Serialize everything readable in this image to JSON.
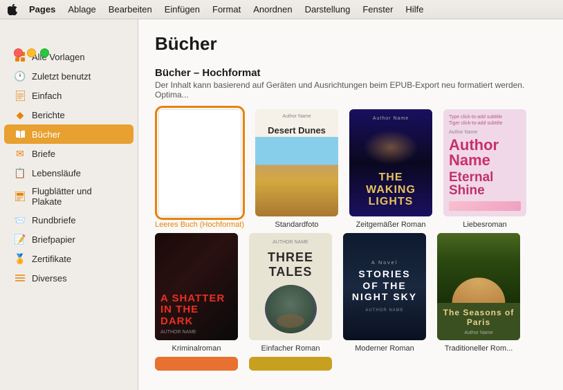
{
  "menubar": {
    "apple": "🍎",
    "items": [
      {
        "label": "Pages",
        "bold": true
      },
      {
        "label": "Ablage"
      },
      {
        "label": "Bearbeiten"
      },
      {
        "label": "Einfügen"
      },
      {
        "label": "Format"
      },
      {
        "label": "Anordnen"
      },
      {
        "label": "Darstellung"
      },
      {
        "label": "Fenster"
      },
      {
        "label": "Hilfe"
      }
    ]
  },
  "sidebar": {
    "items": [
      {
        "id": "alle-vorlagen",
        "label": "Alle Vorlagen",
        "icon": "⊞"
      },
      {
        "id": "zuletzt",
        "label": "Zuletzt benutzt",
        "icon": "🕐"
      },
      {
        "id": "einfach",
        "label": "Einfach",
        "icon": "📄"
      },
      {
        "id": "berichte",
        "label": "Berichte",
        "icon": "◆"
      },
      {
        "id": "buecher",
        "label": "Bücher",
        "icon": "📖",
        "active": true
      },
      {
        "id": "briefe",
        "label": "Briefe",
        "icon": "✉"
      },
      {
        "id": "lebenslaufe",
        "label": "Lebensläufe",
        "icon": "📋"
      },
      {
        "id": "flugblatter",
        "label": "Flugblätter und Plakate",
        "icon": "📰"
      },
      {
        "id": "rundbriefe",
        "label": "Rundbriefe",
        "icon": "📨"
      },
      {
        "id": "briefpapier",
        "label": "Briefpapier",
        "icon": "📝"
      },
      {
        "id": "zertifikate",
        "label": "Zertifikate",
        "icon": "🏅"
      },
      {
        "id": "diverses",
        "label": "Diverses",
        "icon": "☰"
      }
    ]
  },
  "content": {
    "title": "Bücher",
    "section1": {
      "title": "Bücher – Hochformat",
      "desc": "Der Inhalt kann basierend auf Geräten und Ausrichtungen beim EPUB-Export neu formatiert werden. Optima..."
    },
    "templates_row1": [
      {
        "id": "leeres-buch",
        "label": "Leeres Buch (Hochformat)",
        "selected": true,
        "type": "empty"
      },
      {
        "id": "standardfoto",
        "label": "Standardfoto",
        "type": "desert"
      },
      {
        "id": "zeitgemaesser",
        "label": "Zeitgemäßer Roman",
        "type": "waking"
      },
      {
        "id": "liebesroman",
        "label": "Liebesroman",
        "type": "love"
      }
    ],
    "templates_row2": [
      {
        "id": "kriminalroman",
        "label": "Kriminalroman",
        "type": "shatter"
      },
      {
        "id": "einfacher-roman",
        "label": "Einfacher Roman",
        "type": "three"
      },
      {
        "id": "moderner-roman",
        "label": "Moderner Roman",
        "type": "night"
      },
      {
        "id": "traditioneller",
        "label": "Traditioneller Rom...",
        "type": "seasons"
      }
    ]
  }
}
